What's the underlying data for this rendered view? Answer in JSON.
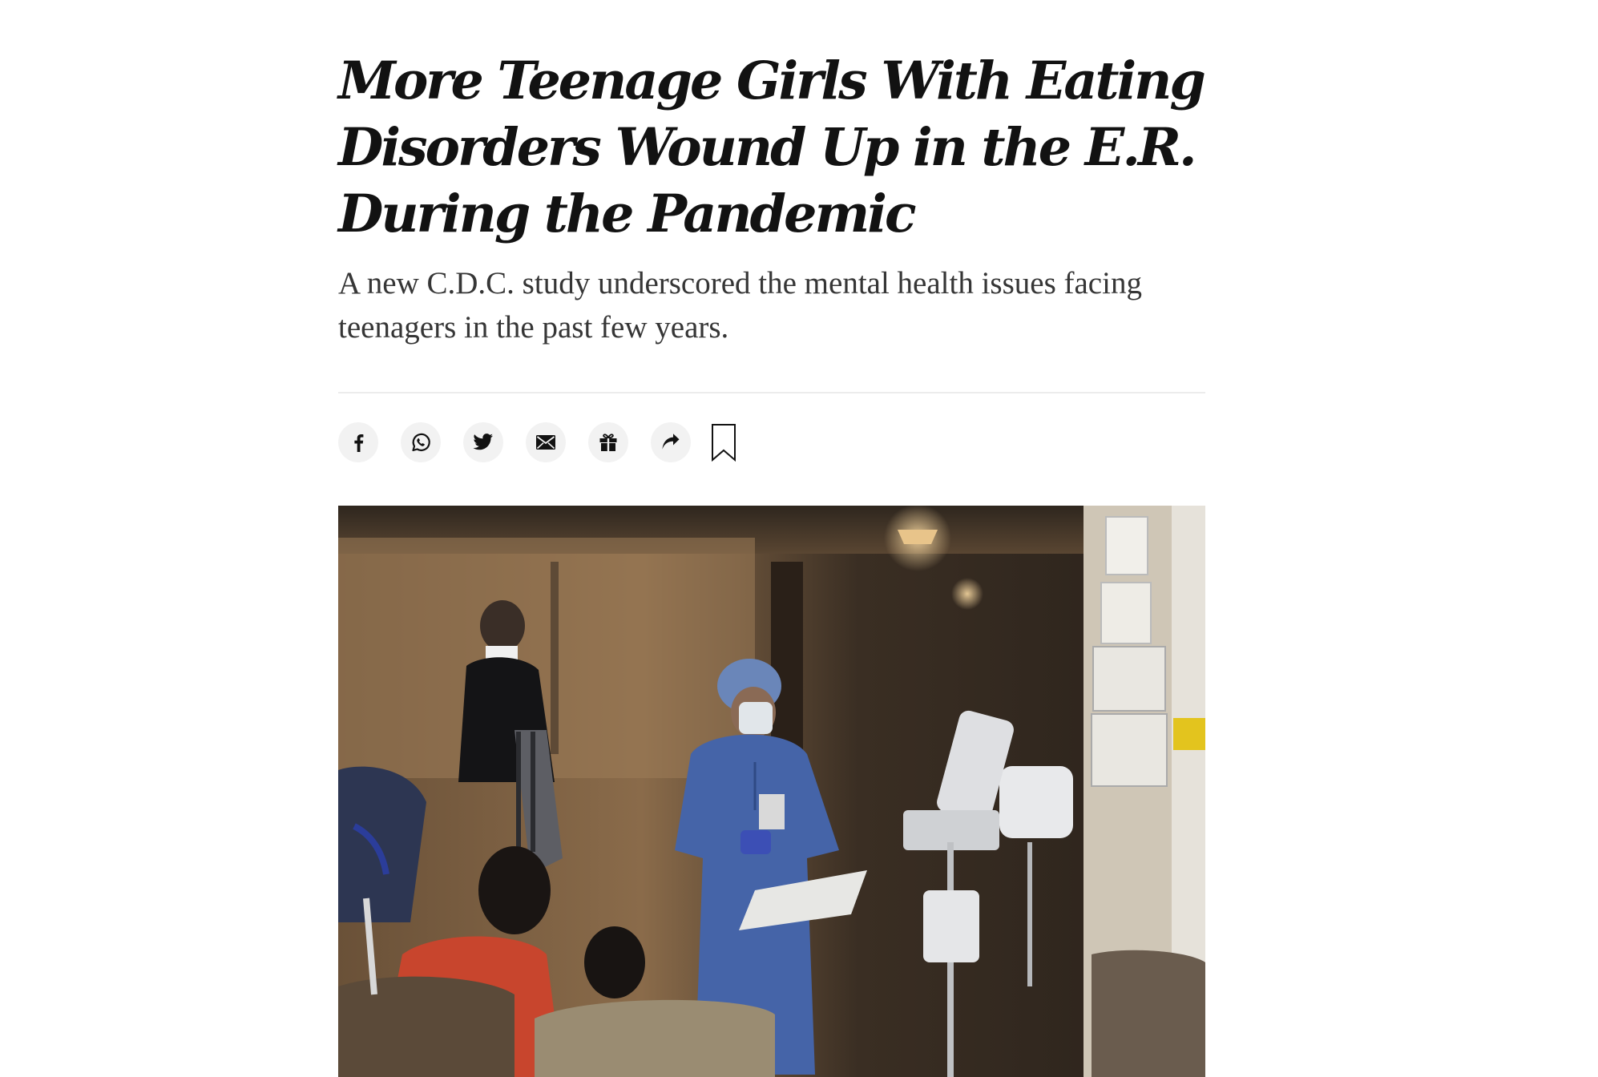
{
  "article": {
    "headline_lines": [
      "More Teenage Girls With Eating",
      "Disorders Wound Up in the E.R.",
      "During the Pandemic"
    ],
    "summary": "A new C.D.C. study underscored the mental health issues facing teenagers in the past few years."
  },
  "share_tools": [
    {
      "name": "facebook",
      "icon": "facebook-icon"
    },
    {
      "name": "whatsapp",
      "icon": "whatsapp-icon"
    },
    {
      "name": "twitter",
      "icon": "twitter-icon"
    },
    {
      "name": "email",
      "icon": "email-icon"
    },
    {
      "name": "gift",
      "icon": "gift-icon"
    },
    {
      "name": "share",
      "icon": "share-arrow-icon"
    },
    {
      "name": "save",
      "icon": "bookmark-icon"
    }
  ],
  "colors": {
    "text": "#121212",
    "summary_text": "#363636",
    "icon_background": "#f2f2f2",
    "divider": "#ececec"
  }
}
